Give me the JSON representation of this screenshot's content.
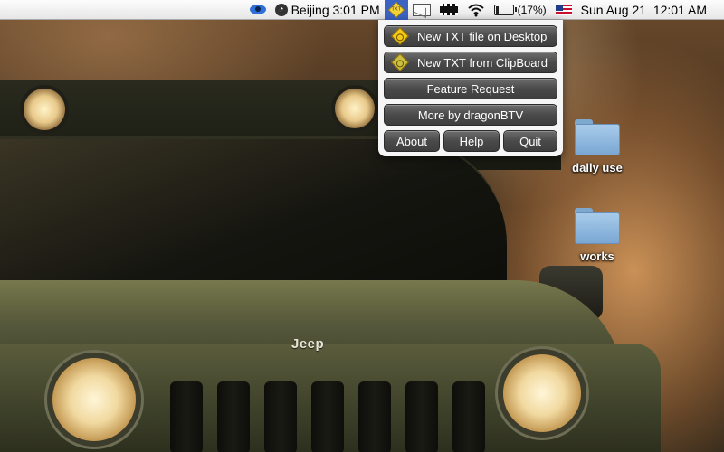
{
  "menubar": {
    "clock_label": "Beijing 3:01 PM",
    "battery_percent_label": "(17%)",
    "battery_level": 0.17,
    "datetime": "Sun Aug 21  12:01 AM",
    "icons": [
      "eye-icon",
      "world-clock-icon",
      "new-txt-app-icon",
      "mail-icon",
      "film-icon",
      "wifi-icon",
      "battery-icon",
      "us-flag-icon"
    ]
  },
  "popup": {
    "new_desktop_label": "New TXT file on Desktop",
    "new_clipboard_label": "New TXT from ClipBoard",
    "feature_request_label": "Feature Request",
    "more_label": "More by dragonBTV",
    "about_label": "About",
    "help_label": "Help",
    "quit_label": "Quit"
  },
  "desktop": {
    "items": [
      {
        "label": "daily use",
        "icon": "folder-icon"
      },
      {
        "label": "works",
        "icon": "folder-icon"
      }
    ]
  },
  "wallpaper": {
    "logo_text": "Jeep"
  },
  "colors": {
    "menu_highlight": "#3b63c4",
    "popup_button": "#4a4a4a",
    "folder": "#8fb8de"
  }
}
